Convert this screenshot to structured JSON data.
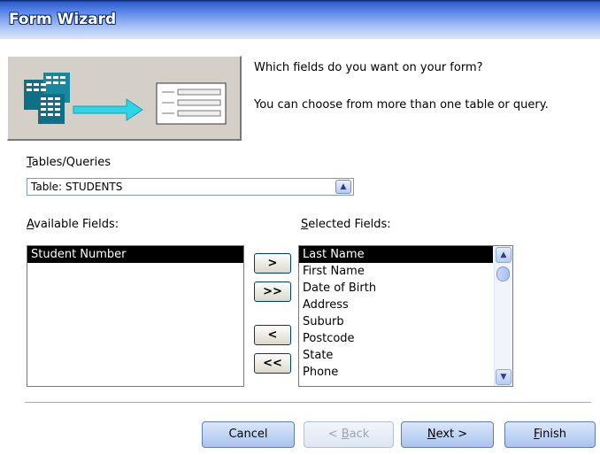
{
  "window": {
    "title": "Form Wizard"
  },
  "intro": {
    "line1": "Which fields do you want on your form?",
    "line2": "You can choose from more than one table or query."
  },
  "tables_queries": {
    "label": "Tables/Queries",
    "value": "Table: STUDENTS"
  },
  "available": {
    "label": "Available Fields:",
    "items": [
      "Student Number"
    ],
    "selected_index": 0
  },
  "selected_fields": {
    "label": "Selected Fields:",
    "items": [
      "Last Name",
      "First Name",
      "Date of Birth",
      "Address",
      "Suburb",
      "Postcode",
      "State",
      "Phone"
    ],
    "selected_index": 0
  },
  "move_buttons": {
    "add_one": ">",
    "add_all": ">>",
    "remove_one": "<",
    "remove_all": "<<"
  },
  "footer": {
    "cancel": "Cancel",
    "back": "< Back",
    "next": "Next >",
    "finish": "Finish"
  },
  "colors": {
    "selection": "#000000",
    "title_text": "#ffffff",
    "button_border": "#5f7fae"
  }
}
